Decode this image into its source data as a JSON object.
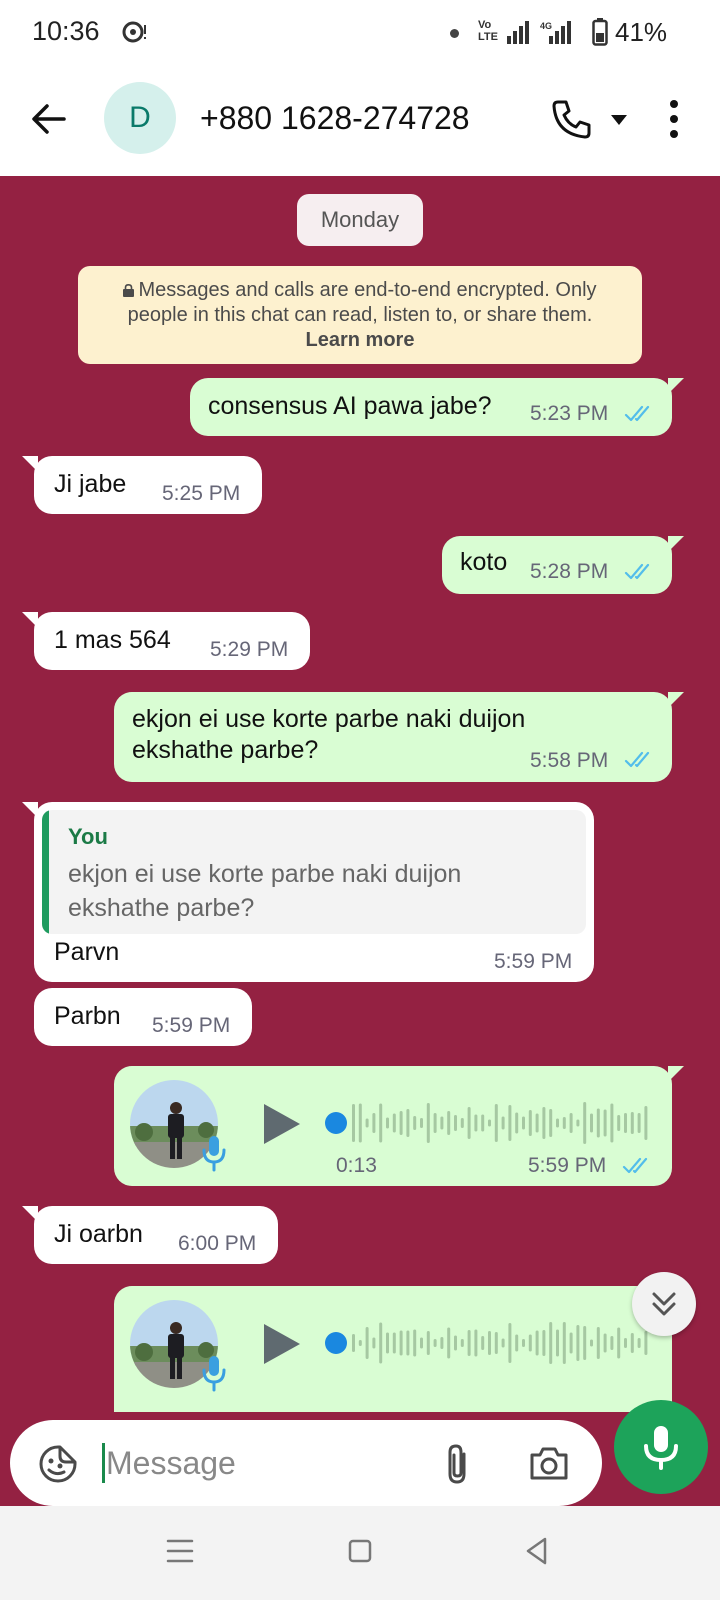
{
  "status_bar": {
    "time": "10:36",
    "volte_line1": "Vo",
    "volte_line2": "LTE",
    "network": "4G",
    "battery": "41%",
    "icons": [
      "notification-icon",
      "dot-icon",
      "volte-icon",
      "signal-icon",
      "battery-icon"
    ]
  },
  "header": {
    "avatar_letter": "D",
    "contact": "+880 1628-274728",
    "icons": [
      "back-arrow-icon",
      "phone-icon",
      "dropdown-icon",
      "more-vert-icon"
    ]
  },
  "chat": {
    "background_color": "#942142",
    "date_chip": "Monday",
    "encryption_notice": {
      "line1": "Messages and calls are end-to-end encrypted. Only",
      "line2": "people in this chat can read, listen to, or share them.",
      "learn_more": "Learn more"
    },
    "messages": [
      {
        "dir": "out",
        "text": "consensus AI pawa jabe?",
        "time": "5:23 PM",
        "read": true
      },
      {
        "dir": "in",
        "text": "Ji jabe",
        "time": "5:25 PM"
      },
      {
        "dir": "out",
        "text": "koto",
        "time": "5:28 PM",
        "read": true
      },
      {
        "dir": "in",
        "text": "1 mas 564",
        "time": "5:29 PM"
      },
      {
        "dir": "out",
        "text_line1": "ekjon ei use korte parbe naki duijon",
        "text_line2": "ekshathe parbe?",
        "time": "5:58 PM",
        "read": true
      },
      {
        "dir": "in",
        "quote_author": "You",
        "quote_line1": "ekjon ei use korte parbe naki duijon",
        "quote_line2": "ekshathe parbe?",
        "text": "Parvn",
        "time": "5:59 PM"
      },
      {
        "dir": "in",
        "text": "Parbn",
        "time": "5:59 PM"
      },
      {
        "dir": "out",
        "type": "voice",
        "duration": "0:13",
        "time": "5:59 PM",
        "read": true
      },
      {
        "dir": "in",
        "text": "Ji oarbn",
        "time": "6:00 PM"
      },
      {
        "dir": "out",
        "type": "voice"
      }
    ]
  },
  "input": {
    "placeholder": "Message",
    "icons": [
      "sticker-icon",
      "attach-icon",
      "camera-icon",
      "mic-icon"
    ]
  },
  "colors": {
    "outgoing": "#d9fdd3",
    "incoming": "#ffffff",
    "accent": "#1da35a",
    "read_ticks": "#53bdeb"
  }
}
